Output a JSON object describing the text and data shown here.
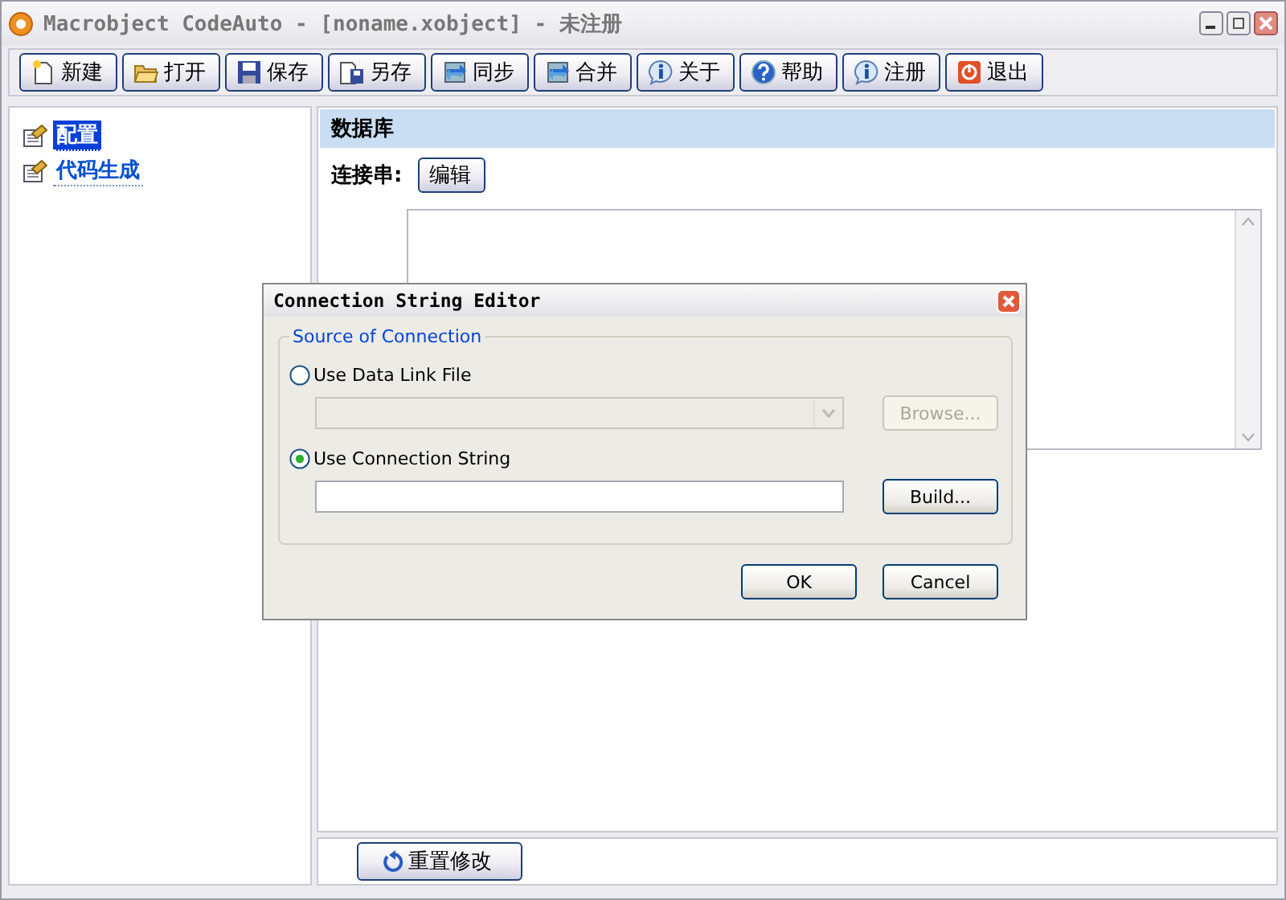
{
  "window": {
    "title": "Macrobject CodeAuto - [noname.xobject] - 未注册"
  },
  "toolbar": [
    {
      "label": "新建",
      "kind": "new"
    },
    {
      "label": "打开",
      "kind": "open"
    },
    {
      "label": "保存",
      "kind": "save"
    },
    {
      "label": "另存",
      "kind": "saveas"
    },
    {
      "label": "同步",
      "kind": "sync"
    },
    {
      "label": "合并",
      "kind": "sync"
    },
    {
      "label": "关于",
      "kind": "info"
    },
    {
      "label": "帮助",
      "kind": "help"
    },
    {
      "label": "注册",
      "kind": "info"
    },
    {
      "label": "退出",
      "kind": "exit"
    }
  ],
  "sidebar": {
    "items": [
      {
        "label": "配置",
        "selected": true
      },
      {
        "label": "代码生成",
        "selected": false
      }
    ]
  },
  "panel": {
    "title": "数据库",
    "connection_label": "连接串:",
    "edit_button": "编辑"
  },
  "footer": {
    "reset_button": "重置修改"
  },
  "dialog": {
    "title": "Connection String Editor",
    "group": "Source of Connection",
    "options": [
      {
        "label": "Use Data Link File",
        "selected": false,
        "button": "Browse...",
        "kind": "combo"
      },
      {
        "label": "Use Connection String",
        "selected": true,
        "button": "Build...",
        "kind": "text"
      }
    ],
    "buttons": [
      "OK",
      "Cancel"
    ]
  }
}
